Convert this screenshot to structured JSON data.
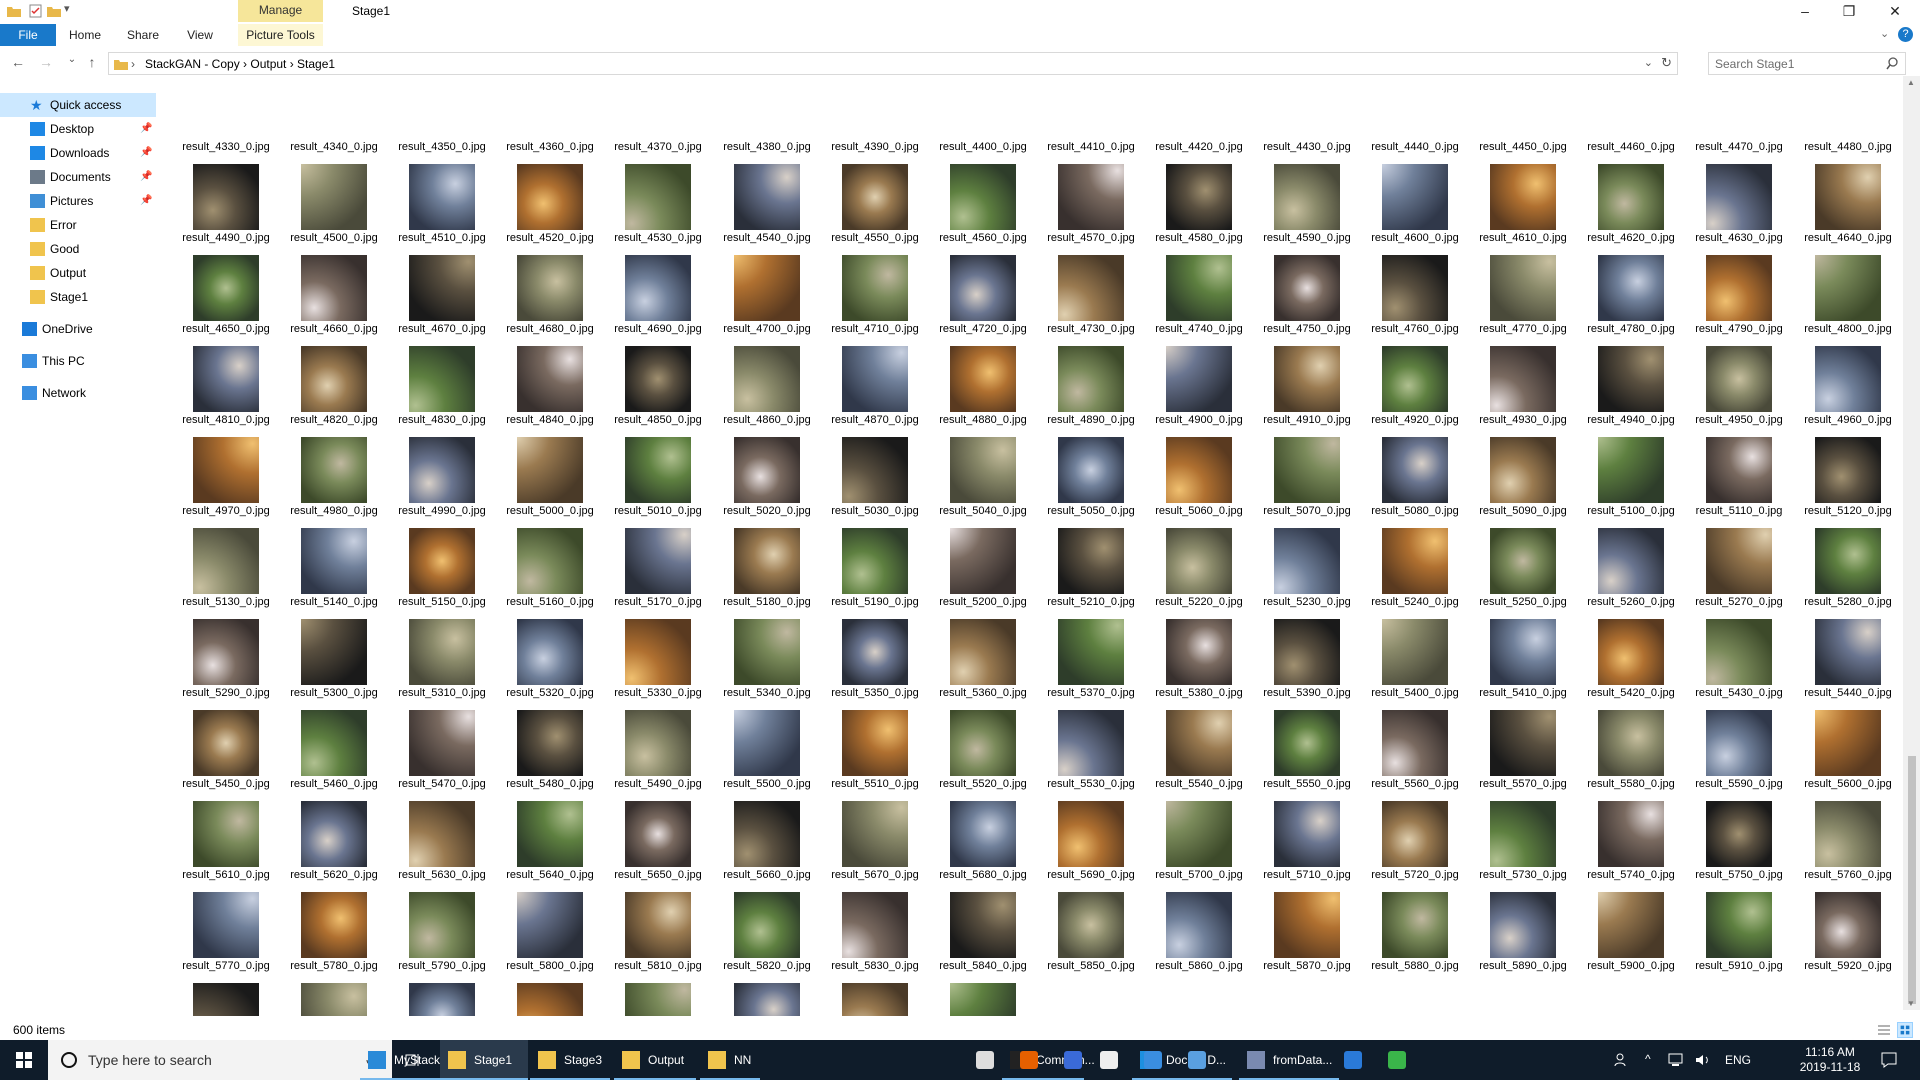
{
  "window": {
    "title": "Stage1",
    "manage_label": "Manage",
    "minimize": "–",
    "maximize": "❐",
    "close": "✕"
  },
  "ribbon": {
    "tabs": [
      "File",
      "Home",
      "Share",
      "View",
      "Picture Tools"
    ]
  },
  "address": {
    "crumbs": "StackGAN - Copy  ›  Output  ›  Stage1",
    "breadcrumb_sep": "›",
    "search_placeholder": "Search Stage1"
  },
  "navpane": {
    "items": [
      {
        "label": "Quick access",
        "icon": "star-icon",
        "pinned": false
      },
      {
        "label": "Desktop",
        "icon": "desktop-icon",
        "pinned": true
      },
      {
        "label": "Downloads",
        "icon": "download-icon",
        "pinned": true
      },
      {
        "label": "Documents",
        "icon": "documents-icon",
        "pinned": true
      },
      {
        "label": "Pictures",
        "icon": "pictures-icon",
        "pinned": true
      },
      {
        "label": "Error",
        "icon": "folder-icon",
        "pinned": false
      },
      {
        "label": "Good",
        "icon": "folder-icon",
        "pinned": false
      },
      {
        "label": "Output",
        "icon": "folder-icon",
        "pinned": false
      },
      {
        "label": "Stage1",
        "icon": "folder-icon",
        "pinned": false
      },
      {
        "label": "OneDrive",
        "icon": "onedrive-icon",
        "pinned": false
      },
      {
        "label": "This PC",
        "icon": "pc-icon",
        "pinned": false
      },
      {
        "label": "Network",
        "icon": "network-icon",
        "pinned": false
      }
    ]
  },
  "files": {
    "start": 4330,
    "end": 6000,
    "step": 10,
    "prefix": "result_",
    "suffix": "_0.jpg"
  },
  "status": {
    "count": "600 items"
  },
  "taskbar": {
    "search_placeholder": "Type here to search",
    "items": [
      "MyStack...",
      "Stage1",
      "Stage3",
      "Output",
      "NN",
      "Comman...",
      "Docker D...",
      "fromData..."
    ],
    "lang": "ENG",
    "time": "11:16 AM",
    "date": "2019-11-18"
  },
  "colors": {
    "accent": "#1979ca",
    "manage": "#f6e69a",
    "taskbar": "#0f1c2a",
    "selected_nav": "#cce8ff"
  }
}
